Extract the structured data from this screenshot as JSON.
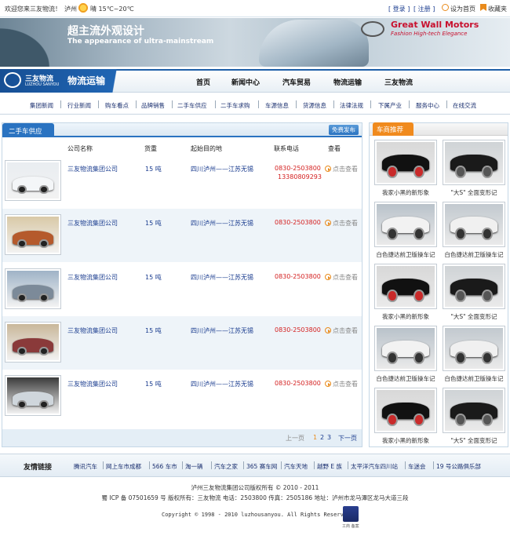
{
  "topbar": {
    "welcome": "欢迎您来三友物流！",
    "city": "泸州",
    "weather": "晴 15℃~20℃",
    "login": "[ 登录 ]",
    "register": "[ 注册 ]",
    "homepage": "设为首页",
    "favorite": "收藏夹"
  },
  "banner": {
    "headline_cn": "超主流外观设计",
    "headline_en": "The appearance of ultra-mainstream",
    "brand": "Great Wall Motors",
    "slogan": "Fashion  High-tech  Elegance"
  },
  "logo": {
    "name_cn": "三友物流",
    "name_en": "LUZHOU SANYOU",
    "section": "物流运输"
  },
  "nav": [
    "首页",
    "新闻中心",
    "汽车贸易",
    "物流运输",
    "三友物流"
  ],
  "subnav": [
    "集团新闻",
    "行业新闻",
    "购车看点",
    "品牌销售",
    "二手车供应",
    "二手车求购",
    "车源信息",
    "货源信息",
    "法律法规",
    "下属产业",
    "服务中心",
    "在线交流"
  ],
  "left": {
    "title": "二手车供应",
    "publish_button": "免费发布",
    "columns": [
      "公司名称",
      "货重",
      "起始目的地",
      "联系电话",
      "查看"
    ],
    "rows": [
      {
        "company": "三友物流集团公司",
        "weight": "15 吨",
        "route": "四川泸州——江苏无锡",
        "phone": "0830-2503800",
        "phone2": "13380809293",
        "view": "点击查看",
        "img_color": "#e9edf1",
        "car_color": "#f4f6f8"
      },
      {
        "company": "三友物流集团公司",
        "weight": "15 吨",
        "route": "四川泸州——江苏无锡",
        "phone": "0830-2503800",
        "phone2": "",
        "view": "点击查看",
        "img_color": "#d9c9a7",
        "car_color": "#b55a2c"
      },
      {
        "company": "三友物流集团公司",
        "weight": "15 吨",
        "route": "四川泸州——江苏无锡",
        "phone": "0830-2503800",
        "phone2": "",
        "view": "点击查看",
        "img_color": "#9fb3c7",
        "car_color": "#7c8a99"
      },
      {
        "company": "三友物流集团公司",
        "weight": "15 吨",
        "route": "四川泸州——江苏无锡",
        "phone": "0830-2503800",
        "phone2": "",
        "view": "点击查看",
        "img_color": "#c9b79a",
        "car_color": "#8a3a3a"
      },
      {
        "company": "三友物流集团公司",
        "weight": "15 吨",
        "route": "四川泸州——江苏无锡",
        "phone": "0830-2503800",
        "phone2": "",
        "view": "点击查看",
        "img_color": "#3a3a3a",
        "car_color": "#cfd6dc"
      }
    ],
    "pager": {
      "prev": "上一页",
      "pages": [
        "1",
        "2",
        "3"
      ],
      "next": "下一页"
    }
  },
  "right": {
    "title": "车商推荐",
    "items": [
      {
        "caption": "我家小黑的新形象",
        "bg": "#d8d8d8",
        "car": "#111111",
        "wheel": "#c92a2a"
      },
      {
        "caption": "\"大S\" 全面变形记",
        "bg": "#cfd3d6",
        "car": "#1a1a1a",
        "wheel": "#555555"
      },
      {
        "caption": "白色捷达前卫版操车记",
        "bg": "#b9c2ca",
        "car": "#f2f2f2",
        "wheel": "#333333"
      },
      {
        "caption": "白色捷达前卫版操车记",
        "bg": "#c2c9cf",
        "car": "#f0f0f0",
        "wheel": "#333333"
      },
      {
        "caption": "我家小黑的新形象",
        "bg": "#d8d8d8",
        "car": "#111111",
        "wheel": "#c92a2a"
      },
      {
        "caption": "\"大S\" 全面变形记",
        "bg": "#cfd3d6",
        "car": "#1a1a1a",
        "wheel": "#555555"
      },
      {
        "caption": "白色捷达前卫版操车记",
        "bg": "#b9c2ca",
        "car": "#f2f2f2",
        "wheel": "#333333"
      },
      {
        "caption": "白色捷达前卫版操车记",
        "bg": "#c2c9cf",
        "car": "#f0f0f0",
        "wheel": "#333333"
      },
      {
        "caption": "我家小黑的新形象",
        "bg": "#d8d8d8",
        "car": "#111111",
        "wheel": "#c92a2a"
      },
      {
        "caption": "\"大S\" 全面变形记",
        "bg": "#cfd3d6",
        "car": "#1a1a1a",
        "wheel": "#555555"
      }
    ]
  },
  "links": {
    "title": "友情链接",
    "items": [
      "腾讯汽车",
      "网上车市成都",
      "566 车市",
      "淘一辆",
      "汽车之家",
      "365 赛车网",
      "汽车天地",
      "越野 E 族",
      "太平洋汽车四川站",
      "车迷会",
      "19 号公路俱乐部"
    ]
  },
  "footer": {
    "line1": "泸州三友物流集团公司版权所有 © 2010 - 2011",
    "line2": "蜀 ICP 备 07501659 号  版权所有：三友物流  电话：2503800   传真：2505186   地址：泸州市龙马潭区龙马大道三段",
    "line3": "Copyright © 1998 - 2010 luzhousanyou. All Rights Reserved",
    "badge": "工商 备案"
  },
  "colors": {
    "accent": "#2a73c1",
    "orange": "#f08a1d",
    "navy": "#164e93"
  }
}
